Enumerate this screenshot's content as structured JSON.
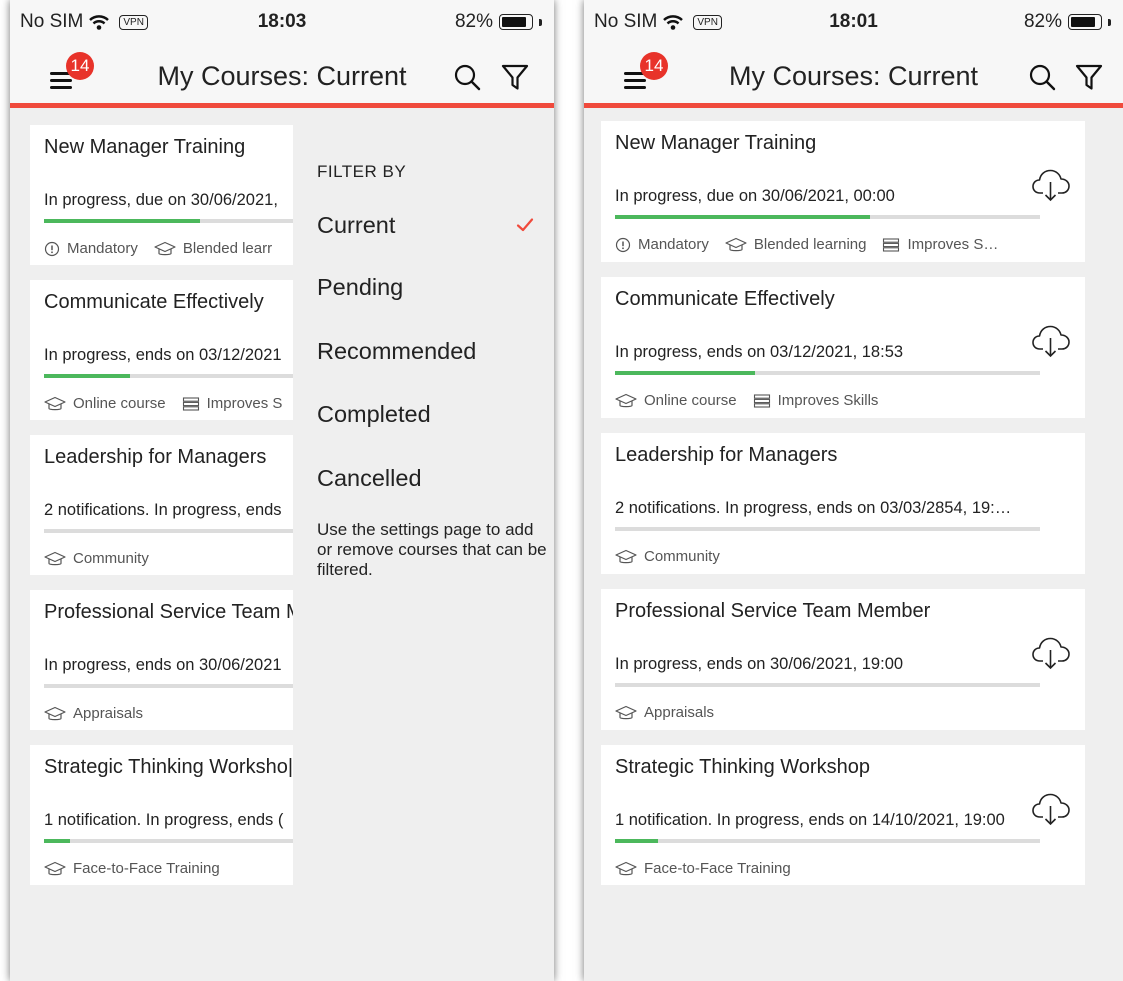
{
  "accent_color": "#f04a3c",
  "progress_color": "#4cb85c",
  "left": {
    "status": {
      "carrier": "No SIM",
      "vpn": "VPN",
      "time": "18:03",
      "battery": "82%"
    },
    "header": {
      "badge_count": "14",
      "title": "My Courses: Current"
    },
    "courses": [
      {
        "title": "New Manager Training",
        "status": "In progress, due on 30/06/2021,",
        "progress": 0.6,
        "tags": [
          "Mandatory",
          "Blended learr"
        ]
      },
      {
        "title": "Communicate Effectively",
        "status": "In progress, ends on 03/12/2021",
        "progress": 0.33,
        "tags": [
          "Online course",
          "Improves S"
        ]
      },
      {
        "title": "Leadership for Managers",
        "status": "2 notifications. In progress, ends",
        "progress": 0,
        "tags": [
          "Community"
        ]
      },
      {
        "title": "Professional Service Team M",
        "status": "In progress, ends on 30/06/2021",
        "progress": 0,
        "tags": [
          "Appraisals"
        ]
      },
      {
        "title": "Strategic Thinking Worksho|",
        "status": "1 notification. In progress, ends (",
        "progress": 0.1,
        "tags": [
          "Face-to-Face Training"
        ]
      }
    ],
    "filter": {
      "heading": "FILTER BY",
      "options": [
        "Current",
        "Pending",
        "Recommended",
        "Completed",
        "Cancelled"
      ],
      "selected": "Current",
      "note": "Use the settings page to add or remove courses that can be filtered."
    }
  },
  "right": {
    "status": {
      "carrier": "No SIM",
      "vpn": "VPN",
      "time": "18:01",
      "battery": "82%"
    },
    "header": {
      "badge_count": "14",
      "title": "My Courses: Current"
    },
    "courses": [
      {
        "title": "New Manager Training",
        "status": "In progress, due on 30/06/2021, 00:00",
        "progress": 0.6,
        "tags": [
          "Mandatory",
          "Blended learning",
          "Improves S…"
        ],
        "download": true
      },
      {
        "title": "Communicate Effectively",
        "status": "In progress, ends on 03/12/2021, 18:53",
        "progress": 0.33,
        "tags": [
          "Online course",
          "Improves Skills"
        ],
        "download": true
      },
      {
        "title": "Leadership for Managers",
        "status": "2 notifications. In progress, ends on 03/03/2854, 19:…",
        "progress": 0,
        "tags": [
          "Community"
        ],
        "download": false
      },
      {
        "title": "Professional Service Team Member",
        "status": "In progress, ends on 30/06/2021, 19:00",
        "progress": 0,
        "tags": [
          "Appraisals"
        ],
        "download": true
      },
      {
        "title": "Strategic Thinking Workshop",
        "status": "1 notification. In progress, ends on 14/10/2021, 19:00",
        "progress": 0.1,
        "tags": [
          "Face-to-Face Training"
        ],
        "download": true
      }
    ]
  }
}
